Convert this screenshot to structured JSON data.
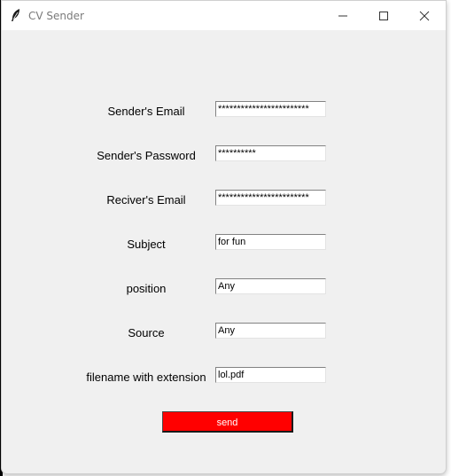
{
  "window": {
    "title": "CV Sender",
    "icon": "feather-icon"
  },
  "form": {
    "sender_email": {
      "label": "Sender's Email",
      "value": "************************"
    },
    "sender_password": {
      "label": "Sender's Password",
      "value": "**********"
    },
    "receiver_email": {
      "label": "Reciver's Email",
      "value": "************************"
    },
    "subject": {
      "label": "Subject",
      "value": "for fun"
    },
    "position": {
      "label": "position",
      "value": "Any"
    },
    "source": {
      "label": "Source",
      "value": "Any"
    },
    "filename": {
      "label": "filename with extension",
      "value": "lol.pdf"
    }
  },
  "send_button": {
    "label": "send",
    "color": "#ff0000"
  }
}
